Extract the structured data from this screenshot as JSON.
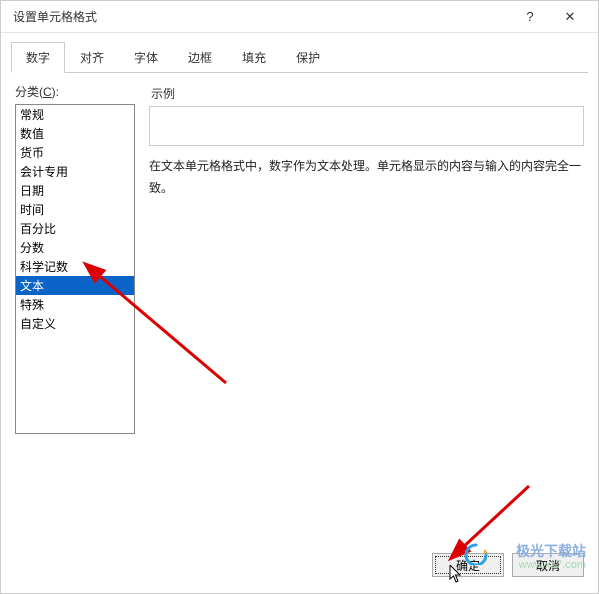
{
  "dialog": {
    "title": "设置单元格格式",
    "help": "?",
    "close": "✕"
  },
  "tabs": [
    {
      "label": "数字",
      "active": true
    },
    {
      "label": "对齐",
      "active": false
    },
    {
      "label": "字体",
      "active": false
    },
    {
      "label": "边框",
      "active": false
    },
    {
      "label": "填充",
      "active": false
    },
    {
      "label": "保护",
      "active": false
    }
  ],
  "category": {
    "label_prefix": "分类(",
    "label_key": "C",
    "label_suffix": "):",
    "items": [
      {
        "label": "常规",
        "selected": false
      },
      {
        "label": "数值",
        "selected": false
      },
      {
        "label": "货币",
        "selected": false
      },
      {
        "label": "会计专用",
        "selected": false
      },
      {
        "label": "日期",
        "selected": false
      },
      {
        "label": "时间",
        "selected": false
      },
      {
        "label": "百分比",
        "selected": false
      },
      {
        "label": "分数",
        "selected": false
      },
      {
        "label": "科学记数",
        "selected": false
      },
      {
        "label": "文本",
        "selected": true
      },
      {
        "label": "特殊",
        "selected": false
      },
      {
        "label": "自定义",
        "selected": false
      }
    ]
  },
  "sample": {
    "label": "示例",
    "value": ""
  },
  "description": "在文本单元格格式中，数字作为文本处理。单元格显示的内容与输入的内容完全一致。",
  "buttons": {
    "ok": "确定",
    "cancel": "取消"
  },
  "watermark": {
    "line1": "极光下载站",
    "line2": "www.xz7.com"
  }
}
